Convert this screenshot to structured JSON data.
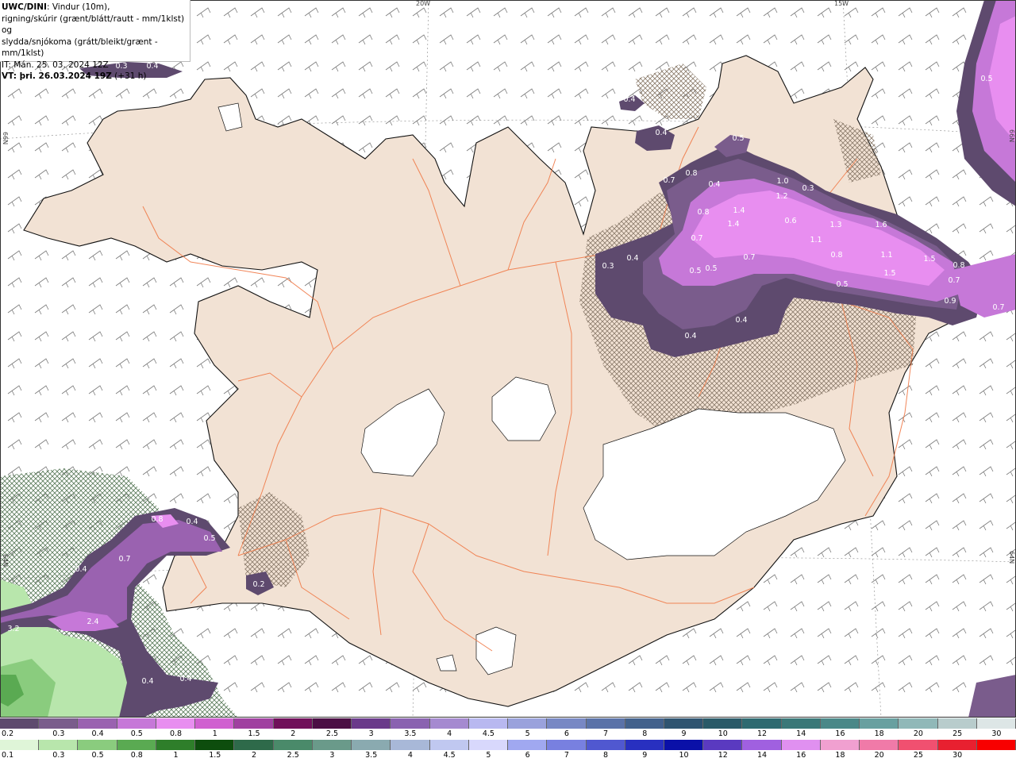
{
  "header": {
    "title": "UWC/DINI",
    "line1": ": Vindur (10m),",
    "line2": "rigning/skúrir (grænt/blátt/rautt - mm/1klst) og",
    "line3": "slydda/snjókoma (grátt/bleikt/grænt - mm/1klst)",
    "line4": "IT: Mán. 25. 03. 2024 12Z",
    "vt_label": "VT: þri. 26.03.2024 19Z",
    "vt_offset": " (+31 h)"
  },
  "grid_labels": {
    "lon_20w": "20W",
    "lon_15w": "15W",
    "lat_66n_left": "66N",
    "lat_66n_right": "66N",
    "lat_64n_left": "64N",
    "lat_64n_right": "64N"
  },
  "field_labels": [
    {
      "text": "0.3"
    },
    {
      "text": "0.4"
    },
    {
      "text": "0.4"
    },
    {
      "text": "0.4"
    },
    {
      "text": "0.5"
    },
    {
      "text": "0.7"
    },
    {
      "text": "0.8"
    },
    {
      "text": "0.4"
    },
    {
      "text": "1.0"
    },
    {
      "text": "1.2"
    },
    {
      "text": "0.3"
    },
    {
      "text": "0.8"
    },
    {
      "text": "1.4"
    },
    {
      "text": "1.4"
    },
    {
      "text": "0.6"
    },
    {
      "text": "1.3"
    },
    {
      "text": "1.6"
    },
    {
      "text": "1.1"
    },
    {
      "text": "0.7"
    },
    {
      "text": "0.7"
    },
    {
      "text": "0.8"
    },
    {
      "text": "1.1"
    },
    {
      "text": "1.5"
    },
    {
      "text": "0.3"
    },
    {
      "text": "0.4"
    },
    {
      "text": "0.5"
    },
    {
      "text": "0.5"
    },
    {
      "text": "1.5"
    },
    {
      "text": "0.8"
    },
    {
      "text": "0.5"
    },
    {
      "text": "0.7"
    },
    {
      "text": "0.9"
    },
    {
      "text": "0.7"
    },
    {
      "text": "0.4"
    },
    {
      "text": "0.4"
    },
    {
      "text": "0.5"
    },
    {
      "text": "0.8"
    },
    {
      "text": "0.4"
    },
    {
      "text": "0.5"
    },
    {
      "text": "0.4"
    },
    {
      "text": "0.7"
    },
    {
      "text": "0.2"
    },
    {
      "text": "2.4"
    },
    {
      "text": "3.2"
    },
    {
      "text": "0.4"
    },
    {
      "text": "0.4"
    }
  ],
  "colorbar_snow": {
    "ticks": [
      "0.2",
      "0.3",
      "0.4",
      "0.5",
      "0.8",
      "1",
      "1.5",
      "2",
      "2.5",
      "3",
      "3.5",
      "4",
      "4.5",
      "5",
      "6",
      "7",
      "8",
      "9",
      "10",
      "12",
      "14",
      "16",
      "18",
      "20",
      "25",
      "30"
    ],
    "colors": [
      "#5e4a6e",
      "#7a5c8c",
      "#9a62b0",
      "#c678d8",
      "#e88ef0",
      "#d060d0",
      "#a040a0",
      "#70105a",
      "#4b0f44",
      "#6a3a8a",
      "#8a62b0",
      "#a58ad0",
      "#b8b8f0",
      "#9aa2dc",
      "#7888c4",
      "#5a72a8",
      "#42618c",
      "#2f5470",
      "#2a5a68",
      "#2e6a70",
      "#3a7878",
      "#4a8888",
      "#68a0a0",
      "#90b8b8",
      "#b8cccc",
      "#dde6e6"
    ]
  },
  "colorbar_rain": {
    "ticks": [
      "0.1",
      "0.3",
      "0.5",
      "0.8",
      "1",
      "1.5",
      "2",
      "2.5",
      "3",
      "3.5",
      "4",
      "4.5",
      "5",
      "6",
      "7",
      "8",
      "9",
      "10",
      "12",
      "14",
      "16",
      "18",
      "20",
      "25",
      "30"
    ],
    "colors": [
      "#dff5d8",
      "#b8e6ac",
      "#8acc7e",
      "#5aaa52",
      "#2e7e2a",
      "#0d4d0d",
      "#2e6a4a",
      "#4a8a6a",
      "#6a9a8a",
      "#8aaab0",
      "#a8b8d8",
      "#c0c8f0",
      "#d8d8fc",
      "#a0a8f0",
      "#7880e0",
      "#5058d0",
      "#2830c0",
      "#0a10a8",
      "#5a3ac0",
      "#a060e0",
      "#e090f0",
      "#f0a0d0",
      "#f07aa8",
      "#f05070",
      "#e82030",
      "#f80000"
    ]
  },
  "colors": {
    "land": "#f2e2d4",
    "sea": "#ffffff",
    "roads": "#f07a48",
    "coast": "#111111",
    "barbs": "#7a7a7a",
    "glacier": "#ffffff",
    "hatch": "#8a7a6a"
  }
}
